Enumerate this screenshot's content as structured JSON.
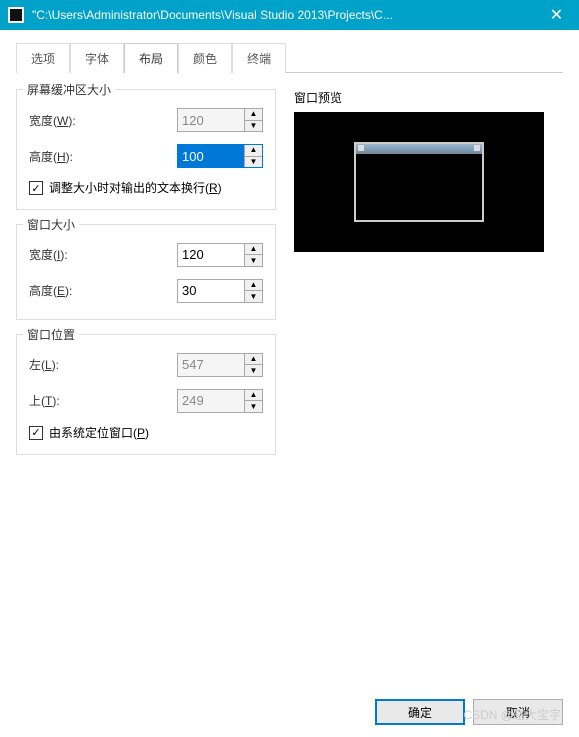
{
  "window": {
    "title": "\"C:\\Users\\Administrator\\Documents\\Visual Studio 2013\\Projects\\C...",
    "close": "✕"
  },
  "tabs": {
    "options": "选项",
    "font": "字体",
    "layout": "布局",
    "color": "颜色",
    "terminal": "终端"
  },
  "buffer": {
    "title": "屏幕缓冲区大小",
    "width_label": "宽度(W):",
    "width_value": "120",
    "height_label": "高度(H):",
    "height_value": "100",
    "wrap_label": "调整大小时对输出的文本换行(R)",
    "wrap_checked": true
  },
  "winsize": {
    "title": "窗口大小",
    "width_label": "宽度(I):",
    "width_value": "120",
    "height_label": "高度(E):",
    "height_value": "30"
  },
  "winpos": {
    "title": "窗口位置",
    "left_label": "左(L):",
    "left_value": "547",
    "top_label": "上(T):",
    "top_value": "249",
    "system_label": "由系统定位窗口(P)",
    "system_checked": true
  },
  "preview": {
    "title": "窗口预览"
  },
  "buttons": {
    "ok": "确定",
    "cancel": "取消"
  },
  "watermark": "CSDN @赵大宝字"
}
